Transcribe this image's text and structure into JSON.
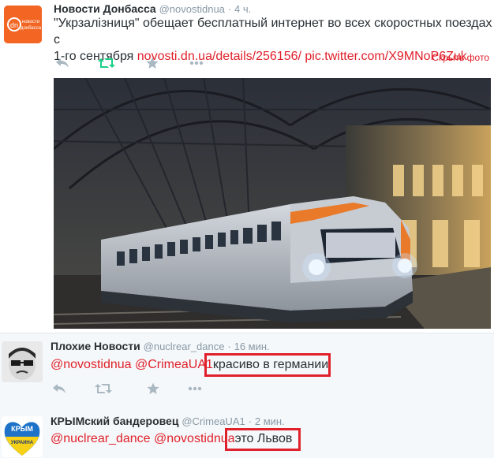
{
  "tweets": [
    {
      "fullname": "Новости Донбасса",
      "username": "@novostidnua",
      "separator": "·",
      "time": "4 ч.",
      "avatar_text_top": "новости",
      "avatar_text_bottom": "донбасса",
      "avatar_badge": "dn",
      "text_line1": "\"Укрзалізниця\" обещает бесплатный интернет во всех скоростных поездах с",
      "text_line2_plain": "1-го сентября ",
      "link1": "novosti.dn.ua/details/256156/",
      "link2": "pic.twitter.com/X9MNoP6Zuk",
      "hide_photo_label": "Скрыть фото"
    },
    {
      "fullname": "Плохие Новости",
      "username": "@nuclrear_dance",
      "separator": "·",
      "time": "16 мин.",
      "mention1": "@novostidnua",
      "mention2": "@CrimeaUA1",
      "text": "красиво в германии"
    },
    {
      "fullname": "КРЫМский бандеровец",
      "username": "@CrimeaUA1",
      "separator": "·",
      "time": "2 мин.",
      "mention1": "@nuclrear_dance",
      "mention2": "@novostidnua",
      "text": "это Львов",
      "avatar_text_top": "КРЫМ",
      "avatar_text_bottom": "УКРАИНА"
    }
  ],
  "icons": {
    "reply": "reply-icon",
    "retweet": "retweet-icon",
    "favorite": "star-icon",
    "more": "more-icon"
  },
  "colors": {
    "link": "#e0202a",
    "retweeted": "#19cf86",
    "muted": "#8899a6",
    "highlight_box": "#e0202a"
  }
}
